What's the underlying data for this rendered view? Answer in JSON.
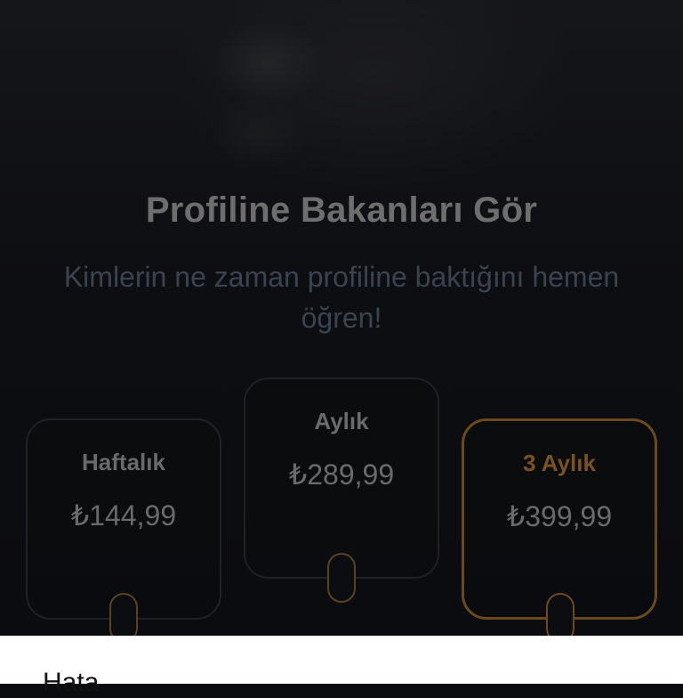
{
  "header": {
    "title": "Profiline Bakanları Gör",
    "subtitle": "Kimlerin ne zaman profiline baktığını hemen öğren!"
  },
  "plans": [
    {
      "name": "Haftalık",
      "price": "₺144,99",
      "selected": false
    },
    {
      "name": "Aylık",
      "price": "₺289,99",
      "selected": false
    },
    {
      "name": "3 Aylık",
      "price": "₺399,99",
      "selected": true
    }
  ],
  "sheet": {
    "title": "Hata"
  },
  "colors": {
    "accent": "#7a5220",
    "overlay": "#0b0c0f",
    "sheet": "#ffffff"
  }
}
